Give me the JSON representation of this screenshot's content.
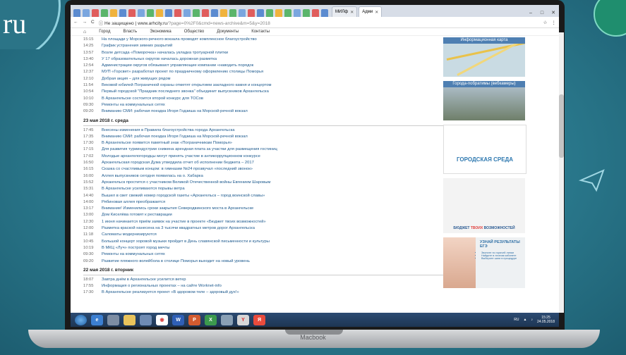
{
  "background": {
    "site_logo": "ru",
    "colors": {
      "bg": "#2d7f93",
      "accent": "#8fd0de"
    }
  },
  "laptop": {
    "brand": "Macbook"
  },
  "browser": {
    "tabs": [
      {
        "label": "МИЛф",
        "active": false
      },
      {
        "label": "Адми",
        "active": true
      }
    ],
    "address": {
      "security": "Не защищено",
      "url_host": "www.arhcity.ru",
      "url_rest": "/?page=0%2F0&cmd=news-archive&m=5&y=2018"
    },
    "icons": {
      "back": "back-arrow-icon",
      "forward": "forward-arrow-icon",
      "reload": "reload-icon",
      "star": "star-icon",
      "menu": "menu-icon"
    }
  },
  "nav": {
    "items": [
      "Город",
      "Власть",
      "Экономика",
      "Общество",
      "Документы",
      "Контакты"
    ]
  },
  "news": {
    "block1": [
      {
        "time": "15:15",
        "text": "На площади у Морского-речного вокзала проводят комплексное благоустройство"
      },
      {
        "time": "14:25",
        "text": "График устранения зимних разрытий"
      },
      {
        "time": "13:57",
        "text": "Возле детсада «Поморочка» началась укладка тротуарной плитки"
      },
      {
        "time": "13:40",
        "text": "У 17 образовательных округов началась дорожная разметка"
      },
      {
        "time": "12:54",
        "text": "Администрации округов обязывают управляющие компании «наводить порядок"
      },
      {
        "time": "12:37",
        "text": "МУП «Горсвет» разработал проект по праздничному оформлению столицы Поморья"
      },
      {
        "time": "12:10",
        "text": "Добрая акция – для живущих рядом"
      },
      {
        "time": "11:54",
        "text": "Вековой юбилей Пограничной охраны отметят открытием закладного камня и концертом"
      },
      {
        "time": "10:54",
        "text": "Первый городской \"Праздник последнего звонка\" объединит выпускников Архангельска"
      },
      {
        "time": "10:10",
        "text": "В Архангельске состоится второй конкурс для ТОСов"
      },
      {
        "time": "09:30",
        "text": "Ремонты на коммунальных сетях"
      },
      {
        "time": "09:20",
        "text": "Вниманию СМИ: рабочая поездка Игоря Годзиша на Морской-речной вокзал"
      }
    ],
    "date2": "23 мая 2018 г. среда",
    "block2": [
      {
        "time": "17:45",
        "text": "Внесены изменения в Правила благоустройства города Архангельска"
      },
      {
        "time": "17:35",
        "text": "Вниманию СМИ: рабочая поездка Игоря Годзиша на Морской-речной вокзал"
      },
      {
        "time": "17:30",
        "text": "В Архангельске появится памятный знак «Пограничникам Поморья»"
      },
      {
        "time": "17:15",
        "text": "Для развития турииндустрии снижена арендная плата за участки для размещения гостиниц"
      },
      {
        "time": "17:02",
        "text": "Молодые архангелогородцы могут принять участие в антикоррупционном конкурсе"
      },
      {
        "time": "16:50",
        "text": "Архангельская городская Дума утвердила отчет об исполнении бюджета – 2017"
      },
      {
        "time": "16:15",
        "text": "Сказка со счастливым концом: в гимназии №24 прозвучал «последний звонок»"
      },
      {
        "time": "16:00",
        "text": "Аллея выпускников сегодня появилась на о. Хабарка"
      },
      {
        "time": "15:52",
        "text": "Архангельск простится с участником Великой Отечественной войны Евгением Шаровым"
      },
      {
        "time": "15:31",
        "text": "В Архангельске усиливаются порывы ветра"
      },
      {
        "time": "14:40",
        "text": "Вышел в свет свежий номер городской газеты «Архангельск – город воинской славы»"
      },
      {
        "time": "14:00",
        "text": "Рябиновая аллея преображается"
      },
      {
        "time": "13:17",
        "text": "Внимание! Изменились сроки закрытия Северодвинского моста в Архангельске"
      },
      {
        "time": "13:00",
        "text": "Дом Киселёва готовят к реставрации"
      },
      {
        "time": "12:30",
        "text": "1 июня начинается приём заявок на участие в проекте «Бюджет твоих возможностей»"
      },
      {
        "time": "12:00",
        "text": "Разметка краской нанесена на 3 тысячи квадратных метров дорог Архангельска"
      },
      {
        "time": "11:18",
        "text": "Саломаты модернизируются"
      },
      {
        "time": "10:45",
        "text": "Большой концерт хоровой музыки пройдет в День славянской письменности и культуры"
      },
      {
        "time": "10:19",
        "text": "В МКЦ «Луч» построят город мечты"
      },
      {
        "time": "09:30",
        "text": "Ремонты на коммунальных сетях"
      },
      {
        "time": "09:20",
        "text": "Развитие пляжного волейбола в столице Поморья выходит на новый уровень"
      }
    ],
    "date3": "22 мая 2018 г. вторник",
    "block3": [
      {
        "time": "18:07",
        "text": "Завтра днём в Архангельске усилится ветер"
      },
      {
        "time": "17:55",
        "text": "Информация о региональных проектах – на сайте Worknet-info"
      },
      {
        "time": "17:30",
        "text": "В Архангельске реализуется проект «В здоровом теле – здоровый дух!»"
      }
    ]
  },
  "sidebar": {
    "map_label": "Информационная карта",
    "twins_label": "Города-побратимы (вебкамеры)",
    "city_env": "ГОРОДСКАЯ СРЕДА",
    "budget_a": "БЮДЖЕТ ",
    "budget_b": "ТВОИХ",
    "budget_c": " ВОЗМОЖНОСТЕЙ",
    "ege_head": "УЗНАЙ РЕЗУЛЬТАТЫ ЕГЭ",
    "ege_items": [
      "Звоните по горячей линии",
      "Найдите в личном кабинете",
      "Выберите шаги в процедуре"
    ]
  },
  "taskbar": {
    "icons": [
      "start-icon",
      "ie-icon",
      "explorer-icon",
      "folder-icon",
      "word-icon",
      "chrome-icon",
      "word-doc-icon",
      "powerpoint-icon",
      "excel-icon",
      "tool-icon",
      "yandex-icon",
      "yandex-browser-icon"
    ],
    "lang": "RU",
    "time": "15:25",
    "date": "24.05.2018"
  }
}
